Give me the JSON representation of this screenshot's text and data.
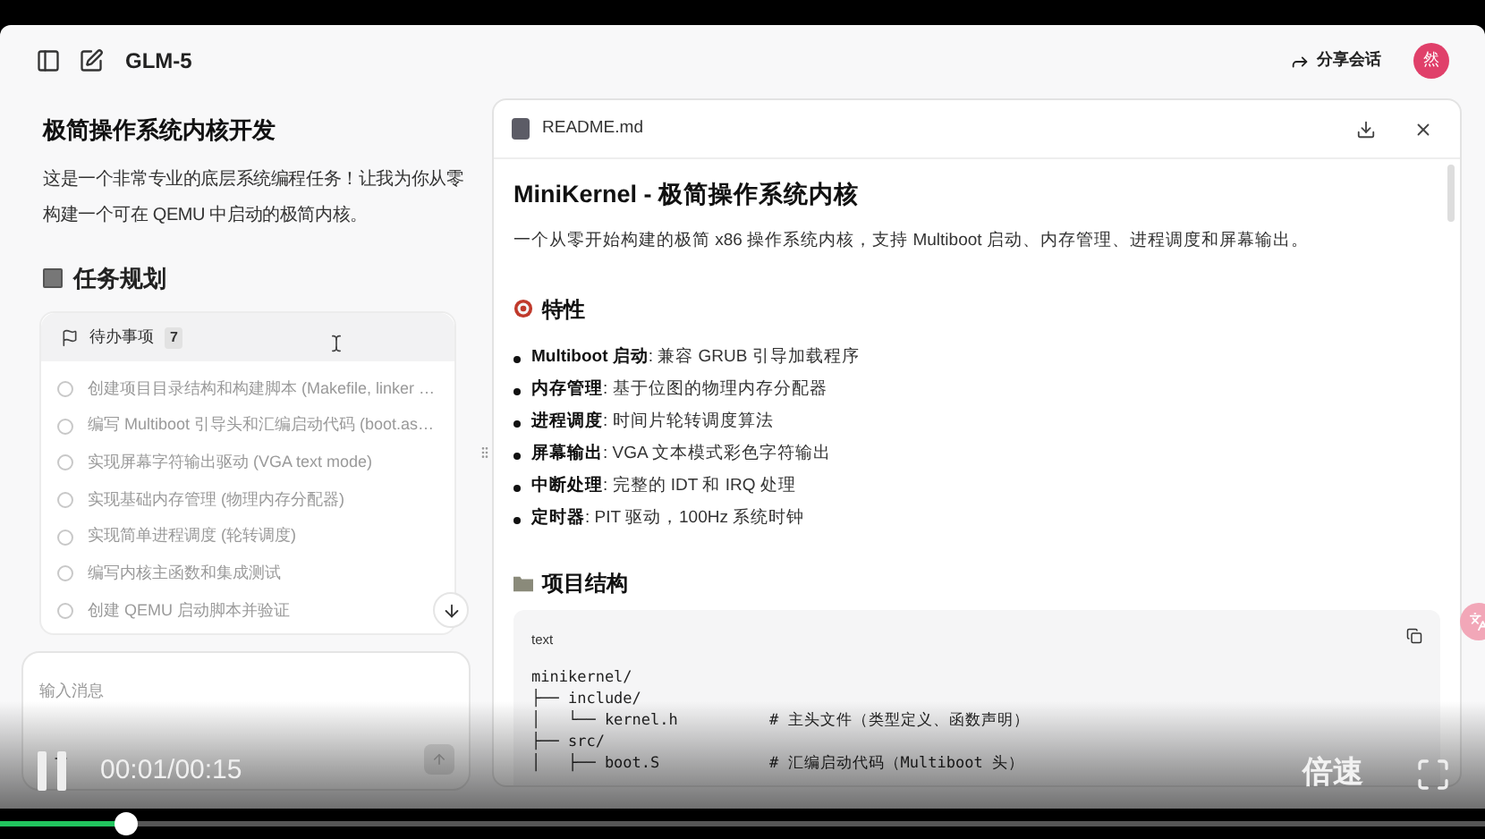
{
  "header": {
    "title": "GLM-5",
    "share": "分享会话",
    "avatar": "然"
  },
  "chat": {
    "title": "极简操作系统内核开发",
    "intro": "这是一个非常专业的底层系统编程任务！让我为你从零构建一个可在 QEMU 中启动的极简内核。",
    "plan_heading": "任务规划",
    "todo": {
      "title": "待办事项",
      "count": "7",
      "items": [
        {
          "text": "创建项目目录结构和构建脚本 (Makefile, linker …",
          "checked": false
        },
        {
          "text": "编写 Multiboot 引导头和汇编启动代码 (boot.as…",
          "checked": false
        },
        {
          "text": "实现屏幕字符输出驱动 (VGA text mode)",
          "checked": false
        },
        {
          "text": "实现基础内存管理 (物理内存分配器)",
          "checked": false
        },
        {
          "text": "实现简单进程调度 (轮转调度)",
          "checked": false
        },
        {
          "text": "编写内核主函数和集成测试",
          "checked": false
        },
        {
          "text": "创建 QEMU 启动脚本并验证",
          "checked": false
        }
      ]
    },
    "input": {
      "placeholder": "输入消息"
    }
  },
  "file": {
    "name": "README.md",
    "h1": "MiniKernel - 极简操作系统内核",
    "desc": "一个从零开始构建的极简 x86 操作系统内核，支持 Multiboot 启动、内存管理、进程调度和屏幕输出。",
    "features_heading": "特性",
    "features": [
      "**Multiboot 启动**: 兼容 GRUB 引导加载程序",
      "**内存管理**: 基于位图的物理内存分配器",
      "**进程调度**: 时间片轮转调度算法",
      "**屏幕输出**: VGA 文本模式彩色字符输出",
      "**中断处理**: 完整的 IDT 和 IRQ 处理",
      "**定时器**: PIT 驱动，100Hz 系统时钟"
    ],
    "structure_heading": "项目结构",
    "code": {
      "lang": "text",
      "lines": [
        "minikernel/",
        "├── include/",
        "│   └── kernel.h          # 主头文件（类型定义、函数声明）",
        "├── src/",
        "│   ├── boot.S            # 汇编启动代码（Multiboot 头）"
      ]
    }
  },
  "video": {
    "playing": true,
    "time": "00:01/00:15",
    "speed": "倍速",
    "level": 0.084
  }
}
